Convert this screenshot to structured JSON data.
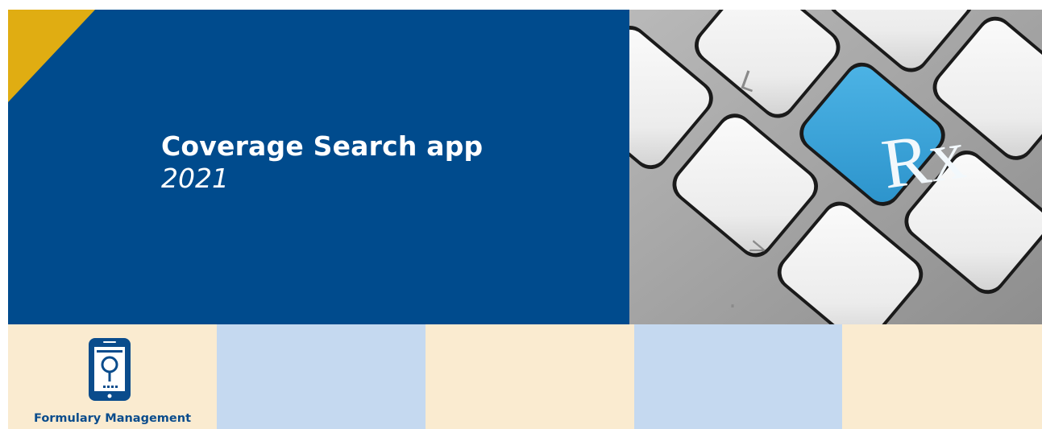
{
  "hero": {
    "title": "Coverage Search app",
    "year": "2021"
  },
  "photo": {
    "key_rx_label": "Rx",
    "key_l_label": "L",
    "key_gt_label": ">",
    "key_dot_label": "."
  },
  "footer": {
    "badge_label": "Formulary Management",
    "icon": "phone-search-icon"
  },
  "colors": {
    "hero_background": "#004b8d",
    "accent_triangle": "#e0ad12",
    "cream_tile": "#faebd0",
    "blue_tile": "#c5d9f0",
    "rx_key": "#3ba7dc",
    "badge_text": "#0a4c8c"
  }
}
